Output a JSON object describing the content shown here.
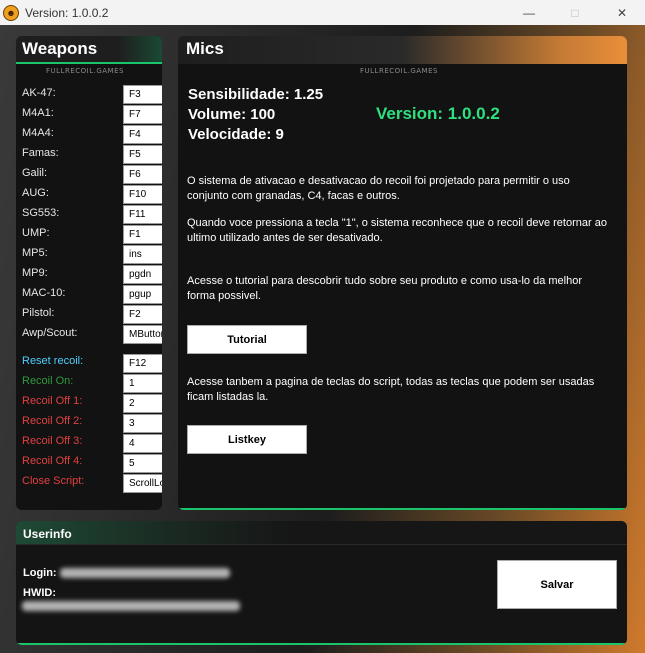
{
  "window": {
    "title": "Version: 1.0.0.2",
    "min_icon": "minimize-icon",
    "max_icon": "maximize-icon",
    "close_icon": "close-icon"
  },
  "weapons": {
    "title": "Weapons",
    "watermark": "FULLRECOIL.GAMES",
    "items": [
      {
        "label": "AK-47:",
        "key": "F3"
      },
      {
        "label": "M4A1:",
        "key": "F7"
      },
      {
        "label": "M4A4:",
        "key": "F4"
      },
      {
        "label": "Famas:",
        "key": "F5"
      },
      {
        "label": "Galil:",
        "key": "F6"
      },
      {
        "label": "AUG:",
        "key": "F10"
      },
      {
        "label": "SG553:",
        "key": "F11"
      },
      {
        "label": "UMP:",
        "key": "F1"
      },
      {
        "label": "MP5:",
        "key": "ins"
      },
      {
        "label": "MP9:",
        "key": "pgdn"
      },
      {
        "label": "MAC-10:",
        "key": "pgup"
      },
      {
        "label": "Pilstol:",
        "key": "F2"
      },
      {
        "label": "Awp/Scout:",
        "key": "MButton"
      }
    ],
    "controls": [
      {
        "label": "Reset recoil:",
        "key": "F12",
        "color": "#4fd0ff"
      },
      {
        "label": "Recoil On:",
        "key": "1",
        "color": "#2e9a3c"
      },
      {
        "label": "Recoil Off 1:",
        "key": "2",
        "color": "#e04040"
      },
      {
        "label": "Recoil Off 2:",
        "key": "3",
        "color": "#e04040"
      },
      {
        "label": "Recoil Off 3:",
        "key": "4",
        "color": "#e04040"
      },
      {
        "label": "Recoil Off 4:",
        "key": "5",
        "color": "#e04040"
      },
      {
        "label": "Close Script:",
        "key": "ScrollLo",
        "color": "#e04040"
      }
    ]
  },
  "mics": {
    "title": "Mics",
    "watermark": "FULLRECOIL.GAMES",
    "sensibilidade": "Sensibilidade: 1.25",
    "volume": "Volume: 100",
    "velocidade": "Velocidade: 9",
    "version": "Version: 1.0.0.2",
    "para1": "O sistema de ativacao e desativacao do recoil foi projetado para permitir o uso conjunto com granadas, C4, facas e outros.",
    "para2": "Quando voce pressiona a tecla \"1\", o sistema reconhece que o recoil deve retornar ao ultimo utilizado antes de ser desativado.",
    "para3": "Acesse o tutorial para descobrir tudo sobre seu produto e como usa-lo da melhor forma possivel.",
    "tutorial_label": "Tutorial",
    "para4": "Acesse tanbem a pagina de teclas do script, todas as teclas que podem ser usadas ficam listadas la.",
    "listkey_label": "Listkey"
  },
  "userinfo": {
    "title": "Userinfo",
    "login_label": "Login:",
    "hwid_label": "HWID:",
    "save_label": "Salvar"
  },
  "colors": {
    "accent_green": "#19c46b",
    "version_green": "#2ee07f",
    "accent_orange": "#e88f3a"
  }
}
